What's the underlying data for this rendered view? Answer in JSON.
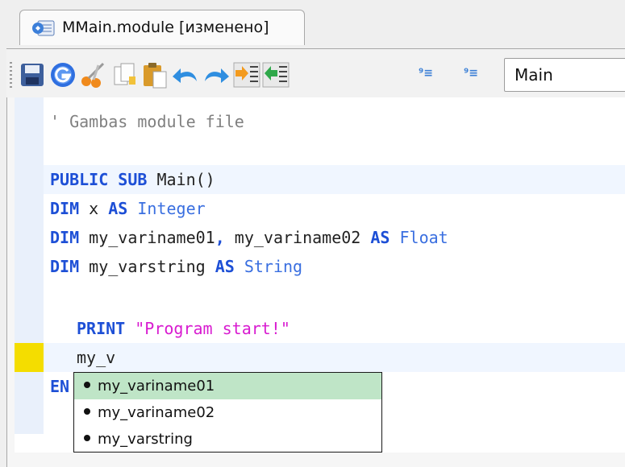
{
  "tab": {
    "label": "MMain.module [изменено]",
    "icon": "module-icon"
  },
  "toolbar": {
    "buttons": [
      "save-icon",
      "compile-icon",
      "cut-icon",
      "copy-icon",
      "paste-icon",
      "undo-icon",
      "redo-icon",
      "indent-icon",
      "unindent-icon",
      "bookmark-icon",
      "bookmark-next-icon"
    ],
    "small_glyph_1": "⁹≡",
    "small_glyph_2": "⁹≡",
    "procedure": "Main"
  },
  "editor": {
    "comment": "' Gambas module file",
    "l1_kw1": "PUBLIC SUB",
    "l1_rest": " Main()",
    "l2_kw": "DIM",
    "l2_mid": " x ",
    "l2_kw2": "AS",
    "l2_type": " Integer",
    "l3_kw": "DIM",
    "l3_mid": " my_variname01",
    "l3_comma": ",",
    "l3_mid2": " my_variname02 ",
    "l3_kw2": "AS",
    "l3_type": " Float",
    "l4_kw": "DIM",
    "l4_mid": " my_varstring ",
    "l4_kw2": "AS",
    "l4_type": " String",
    "l6_kw": "PRINT",
    "l6_str": " \"Program start!\"",
    "l7_text": "my_v",
    "l8_kw": "EN"
  },
  "autocomplete": {
    "items": [
      "my_variname01",
      "my_variname02",
      "my_varstring"
    ],
    "selected_index": 0
  },
  "colors": {
    "keyword": "#1d4fd6",
    "string": "#d81bd0",
    "comment": "#808080",
    "selection": "#bfe5c7",
    "gutter_mark": "#f4dd00"
  }
}
